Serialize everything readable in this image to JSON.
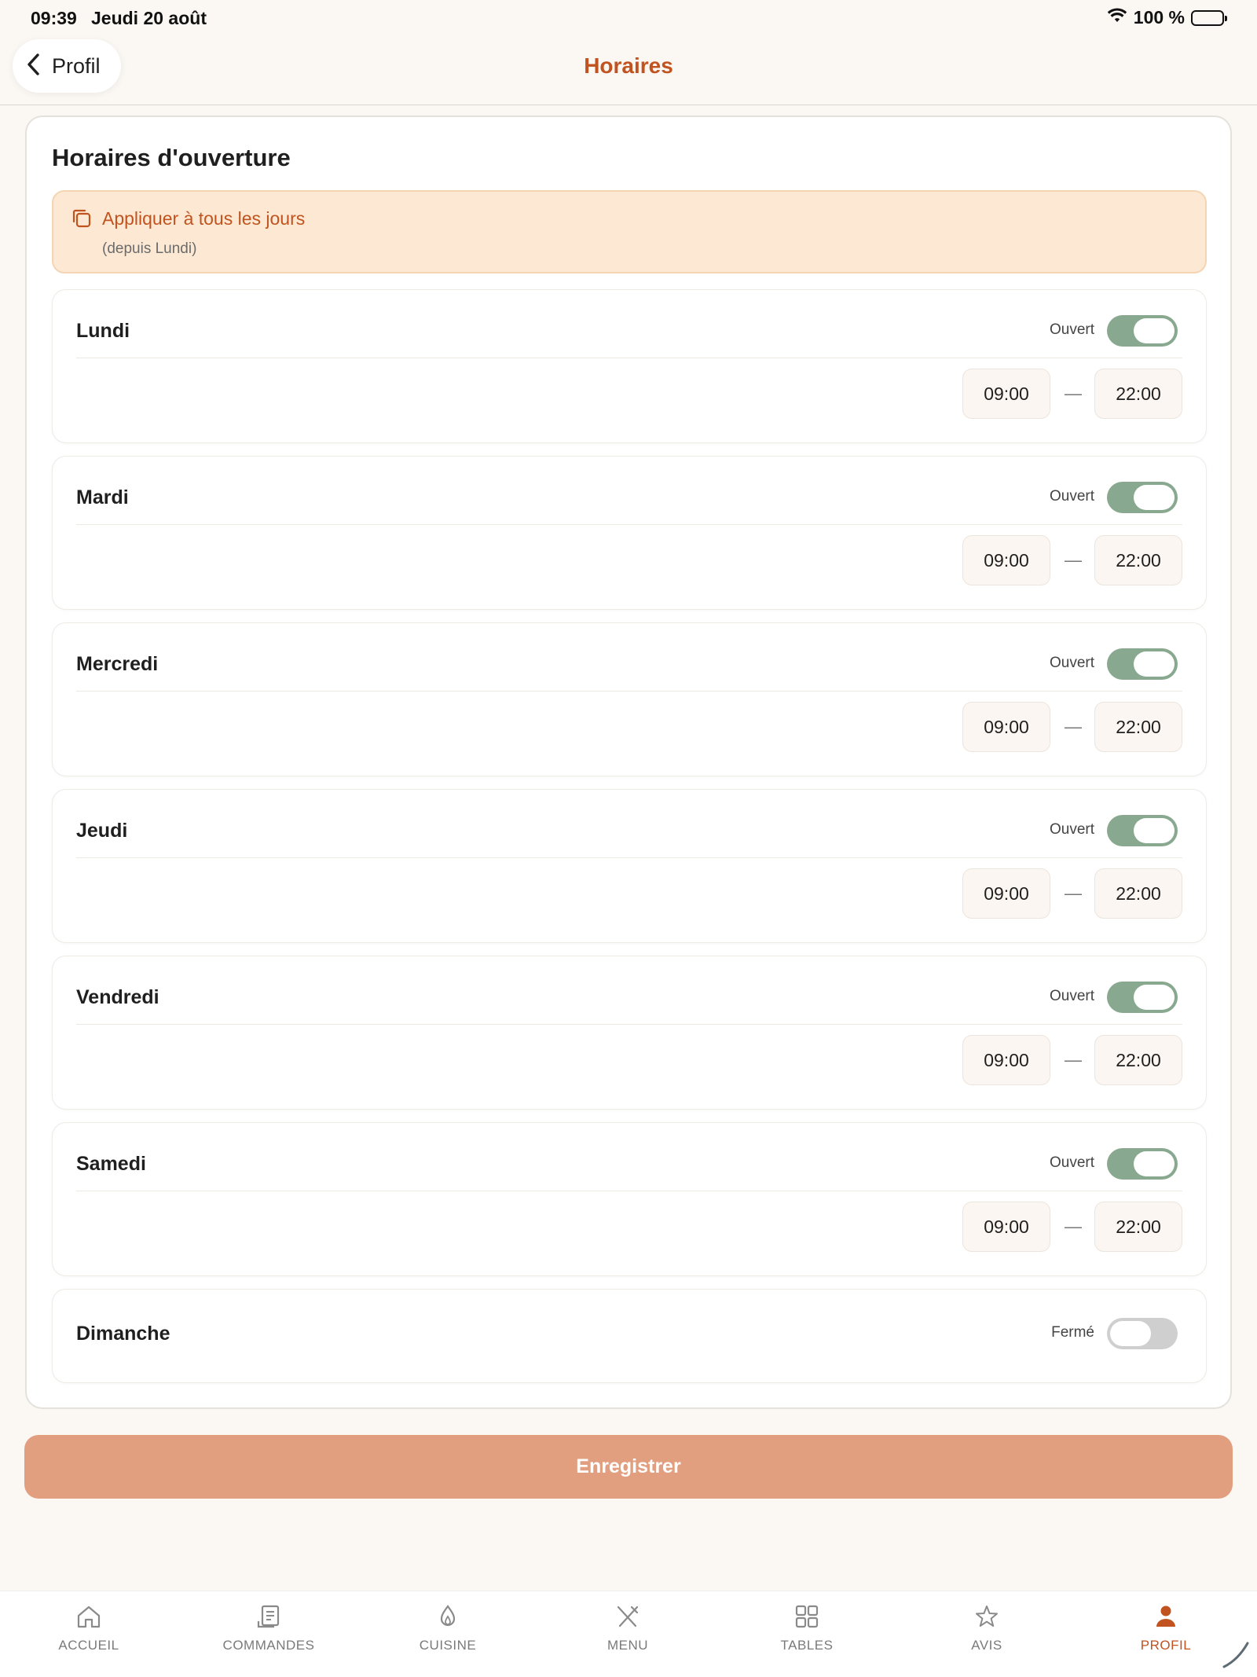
{
  "status_bar": {
    "time": "09:39",
    "date": "Jeudi 20 août",
    "battery": "100 %"
  },
  "header": {
    "back_label": "Profil",
    "title": "Horaires"
  },
  "card": {
    "title": "Horaires d'ouverture",
    "apply_all": {
      "label": "Appliquer à tous les jours",
      "sub": "(depuis Lundi)"
    },
    "dash": "—",
    "days": [
      {
        "name": "Lundi",
        "status": "Ouvert",
        "open": true,
        "start": "09:00",
        "end": "22:00"
      },
      {
        "name": "Mardi",
        "status": "Ouvert",
        "open": true,
        "start": "09:00",
        "end": "22:00"
      },
      {
        "name": "Mercredi",
        "status": "Ouvert",
        "open": true,
        "start": "09:00",
        "end": "22:00"
      },
      {
        "name": "Jeudi",
        "status": "Ouvert",
        "open": true,
        "start": "09:00",
        "end": "22:00"
      },
      {
        "name": "Vendredi",
        "status": "Ouvert",
        "open": true,
        "start": "09:00",
        "end": "22:00"
      },
      {
        "name": "Samedi",
        "status": "Ouvert",
        "open": true,
        "start": "09:00",
        "end": "22:00"
      },
      {
        "name": "Dimanche",
        "status": "Fermé",
        "open": false
      }
    ]
  },
  "save_label": "Enregistrer",
  "tabbar": {
    "items": [
      {
        "label": "ACCUEIL",
        "icon": "home-icon"
      },
      {
        "label": "COMMANDES",
        "icon": "receipt-icon"
      },
      {
        "label": "CUISINE",
        "icon": "flame-icon"
      },
      {
        "label": "MENU",
        "icon": "utensils-icon"
      },
      {
        "label": "TABLES",
        "icon": "grid-icon"
      },
      {
        "label": "AVIS",
        "icon": "star-icon"
      },
      {
        "label": "PROFIL",
        "icon": "user-icon",
        "active": true
      }
    ]
  },
  "colors": {
    "accent": "#c0531f",
    "toggle_on": "#88a98f",
    "toggle_off": "#cfcfcf",
    "save_button": "#e29f80",
    "apply_box": "#fde9d3"
  }
}
